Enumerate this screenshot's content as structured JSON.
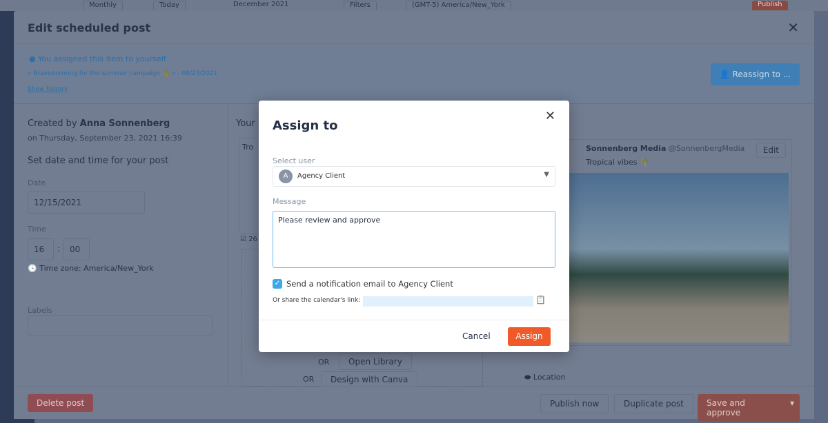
{
  "topbar": {
    "view": "Monthly",
    "today": "Today",
    "month": "December 2021",
    "filters": "Filters",
    "timezone": "(GMT-5) America/New_York",
    "publish": "Publish"
  },
  "edit_modal": {
    "title": "Edit scheduled post",
    "assignment": {
      "text": "You assigned this item to yourself",
      "campaign": "« Brainstorming for the summer campaign 🌴 » - 09/23/2021",
      "show_history": "Show history",
      "reassign": "Reassign to ..."
    },
    "left": {
      "created_by_prefix": "Created by",
      "author": "Anna Sonnenberg",
      "created_on": "on Thursday, September 23, 2021 16:39",
      "set_date_title": "Set date and time for your post",
      "date_label": "Date",
      "date_value": "12/15/2021",
      "time_label": "Time",
      "hour": "16",
      "minute": "00",
      "time_sep": ":",
      "timezone": "Time zone: America/New_York",
      "labels_label": "Labels"
    },
    "middle": {
      "heading": "Your",
      "text_start": "Tro",
      "char_count": "26",
      "open_library": "Open Library",
      "design_canva": "Design with Canva",
      "or": "OR"
    },
    "right": {
      "account": "Sonnenberg Media",
      "handle": "@SonnenbergMedia",
      "caption": "Tropical vibes 🌴",
      "edit": "Edit",
      "location": "Location"
    },
    "footer": {
      "delete": "Delete post",
      "publish_now": "Publish now",
      "duplicate": "Duplicate post",
      "save_approve": "Save and approve"
    }
  },
  "dialog": {
    "title": "Assign to",
    "select_label": "Select user",
    "selected_user": "Agency Client",
    "avatar_initial": "A",
    "message_label": "Message",
    "message_value": "Please review and approve",
    "notify_label": "Send a notification email to Agency Client",
    "notify_checked": true,
    "share_label": "Or share the calendar's link:",
    "cancel": "Cancel",
    "assign": "Assign"
  },
  "colors": {
    "accent_orange": "#f05a28",
    "link_blue": "#2a8fd6",
    "checkbox_blue": "#3ea7e8"
  }
}
